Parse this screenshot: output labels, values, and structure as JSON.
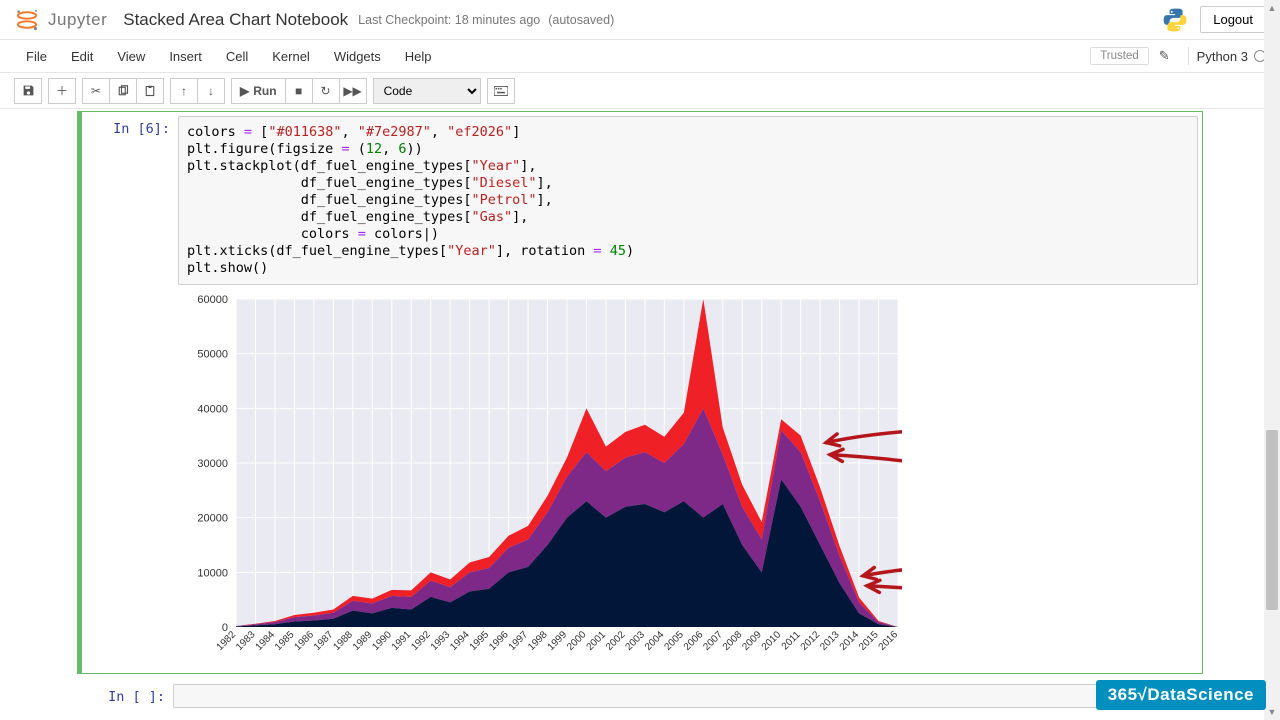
{
  "header": {
    "logo_text": "Jupyter",
    "title": "Stacked Area Chart Notebook",
    "checkpoint": "Last Checkpoint: 18 minutes ago",
    "autosaved": "(autosaved)",
    "logout": "Logout"
  },
  "menu": {
    "items": [
      "File",
      "Edit",
      "View",
      "Insert",
      "Cell",
      "Kernel",
      "Widgets",
      "Help"
    ],
    "trusted": "Trusted",
    "kernel": "Python 3"
  },
  "toolbar": {
    "run": "Run",
    "celltype": "Code"
  },
  "cell": {
    "prompt": "In [6]:",
    "code_html": "colors <span class='op'>=</span> [<span class='s'>\"#011638\"</span>, <span class='s'>\"#7e2987\"</span>, <span class='s'>\"ef2026\"</span>]\nplt.figure(figsize <span class='op'>=</span> (<span class='n'>12</span>, <span class='n'>6</span>))\nplt.stackplot(df_fuel_engine_types[<span class='s'>\"Year\"</span>],\n              df_fuel_engine_types[<span class='s'>\"Diesel\"</span>],\n              df_fuel_engine_types[<span class='s'>\"Petrol\"</span>],\n              df_fuel_engine_types[<span class='s'>\"Gas\"</span>],\n              colors <span class='op'>=</span> colors|)\nplt.xticks(df_fuel_engine_types[<span class='s'>\"Year\"</span>], rotation <span class='op'>=</span> <span class='n'>45</span>)\nplt.show()"
  },
  "empty_cell": {
    "prompt": "In [ ]:"
  },
  "watermark": "365√DataScience",
  "chart_data": {
    "type": "area",
    "title": "",
    "xlabel": "",
    "ylabel": "",
    "ylim": [
      0,
      60000
    ],
    "yticks": [
      0,
      10000,
      20000,
      30000,
      40000,
      50000,
      60000
    ],
    "categories": [
      "1982",
      "1983",
      "1984",
      "1985",
      "1986",
      "1987",
      "1988",
      "1989",
      "1990",
      "1991",
      "1992",
      "1993",
      "1994",
      "1995",
      "1996",
      "1997",
      "1998",
      "1999",
      "2000",
      "2001",
      "2002",
      "2003",
      "2004",
      "2005",
      "2006",
      "2007",
      "2008",
      "2009",
      "2010",
      "2011",
      "2012",
      "2013",
      "2014",
      "2015",
      "2016"
    ],
    "series": [
      {
        "name": "Diesel",
        "color": "#011638",
        "values": [
          100,
          300,
          500,
          1000,
          1200,
          1500,
          3000,
          2500,
          3500,
          3200,
          5500,
          4500,
          6500,
          7000,
          10000,
          11000,
          15000,
          20000,
          23000,
          20000,
          22000,
          22500,
          21000,
          23000,
          20000,
          22500,
          15000,
          10000,
          27000,
          22000,
          15000,
          8000,
          2500,
          500,
          0
        ]
      },
      {
        "name": "Petrol",
        "color": "#7e2987",
        "values": [
          50,
          200,
          400,
          800,
          900,
          1100,
          1800,
          1800,
          2200,
          2300,
          3000,
          2800,
          3500,
          3800,
          4500,
          5000,
          6000,
          7500,
          9000,
          8500,
          9000,
          9500,
          9000,
          10500,
          20000,
          9000,
          7000,
          6000,
          9000,
          10000,
          8000,
          5000,
          2000,
          400,
          0
        ]
      },
      {
        "name": "Gas",
        "color": "#ef2026",
        "values": [
          30,
          100,
          200,
          400,
          500,
          600,
          900,
          900,
          1100,
          1200,
          1500,
          1400,
          1800,
          2000,
          2200,
          2500,
          3000,
          3500,
          8000,
          4500,
          4700,
          5000,
          4800,
          5700,
          20000,
          5000,
          4000,
          3200,
          2000,
          3000,
          2500,
          1800,
          900,
          200,
          0
        ]
      }
    ]
  }
}
